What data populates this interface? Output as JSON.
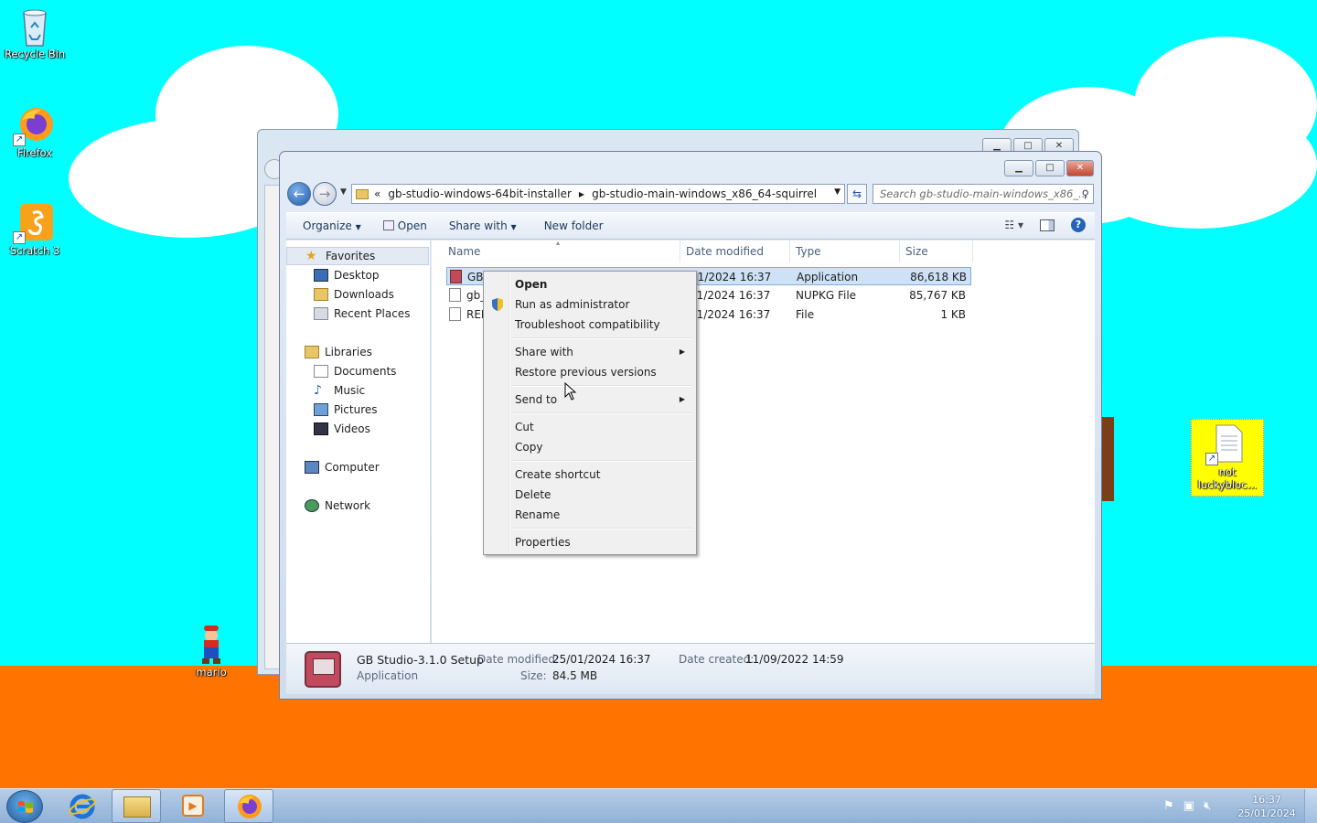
{
  "desktop": {
    "icons": [
      {
        "label": "Recycle Bin",
        "icon": "recycle-bin-icon"
      },
      {
        "label": "Firefox",
        "icon": "firefox-icon"
      },
      {
        "label": "Scratch 3",
        "icon": "scratch-icon"
      },
      {
        "label": "mario",
        "icon": "mario-icon"
      },
      {
        "label": "not luckybloc...",
        "icon": "text-document-icon"
      }
    ]
  },
  "explorer": {
    "breadcrumb": {
      "overflow": "«",
      "segments": [
        "gb-studio-windows-64bit-installer",
        "gb-studio-main-windows_x86_64-squirrel"
      ]
    },
    "search_placeholder": "Search gb-studio-main-windows_x86_...",
    "toolbar": {
      "organize": "Organize",
      "open": "Open",
      "share_with": "Share with",
      "new_folder": "New folder"
    },
    "nav": {
      "favorites": "Favorites",
      "desktop": "Desktop",
      "downloads": "Downloads",
      "recent_places": "Recent Places",
      "libraries": "Libraries",
      "documents": "Documents",
      "music": "Music",
      "pictures": "Pictures",
      "videos": "Videos",
      "computer": "Computer",
      "network": "Network"
    },
    "columns": {
      "name": "Name",
      "date_modified": "Date modified",
      "type": "Type",
      "size": "Size"
    },
    "files": [
      {
        "name": "GB",
        "date": "/01/2024 16:37",
        "type": "Application",
        "size": "86,618 KB",
        "selected": true
      },
      {
        "name": "gb_",
        "date": "/01/2024 16:37",
        "type": "NUPKG File",
        "size": "85,767 KB",
        "selected": false
      },
      {
        "name": "REL",
        "date": "/01/2024 16:37",
        "type": "File",
        "size": "1 KB",
        "selected": false
      }
    ],
    "details": {
      "name": "GB Studio-3.1.0 Setup",
      "kind": "Application",
      "date_modified_label": "Date modified:",
      "date_modified": "25/01/2024 16:37",
      "size_label": "Size:",
      "size": "84.5 MB",
      "date_created_label": "Date created:",
      "date_created": "11/09/2022 14:59"
    }
  },
  "context_menu": {
    "open": "Open",
    "run_as_admin": "Run as administrator",
    "troubleshoot": "Troubleshoot compatibility",
    "share_with": "Share with",
    "restore": "Restore previous versions",
    "send_to": "Send to",
    "cut": "Cut",
    "copy": "Copy",
    "create_shortcut": "Create shortcut",
    "delete": "Delete",
    "rename": "Rename",
    "properties": "Properties"
  },
  "taskbar": {
    "time": "16:37",
    "date": "25/01/2024",
    "apps": [
      "internet-explorer-icon",
      "file-explorer-icon",
      "media-player-icon",
      "firefox-icon"
    ]
  },
  "colors": {
    "sky": "#00ffff",
    "ground": "#ff7400",
    "selection": "#cde1f7"
  }
}
